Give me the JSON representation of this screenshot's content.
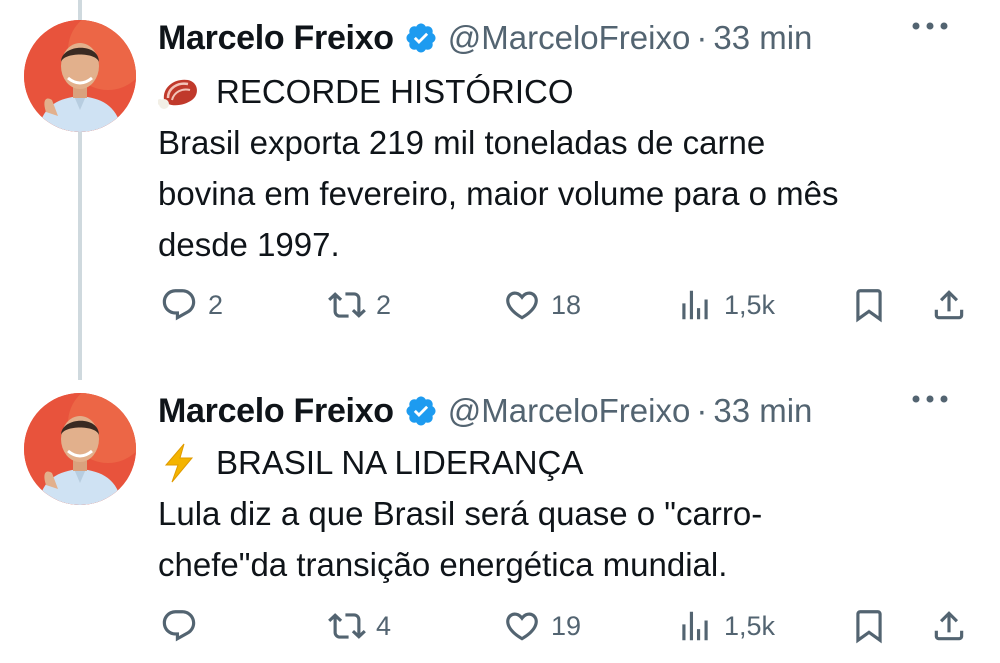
{
  "tweets": [
    {
      "name": "Marcelo Freixo",
      "handle": "@MarceloFreixo",
      "separator": "·",
      "time": "33 min",
      "title": "RECORDE HISTÓRICO",
      "title_emoji": "meat-on-bone-icon",
      "body": [
        "Brasil exporta 219 mil toneladas de carne",
        "bovina em fevereiro, maior volume para o mês",
        "desde 1997."
      ],
      "replies": "2",
      "retweets": "2",
      "likes": "18",
      "views": "1,5k"
    },
    {
      "name": "Marcelo Freixo",
      "handle": "@MarceloFreixo",
      "separator": "·",
      "time": "33 min",
      "title": "BRASIL NA LIDERANÇA",
      "title_emoji": "lightning-icon",
      "body": [
        "Lula diz a que Brasil será quase o \"carro-",
        "chefe\"da transição energética mundial."
      ],
      "replies": "",
      "retweets": "4",
      "likes": "19",
      "views": "1,5k"
    }
  ],
  "colors": {
    "verified_blue": "#1d9bf0",
    "muted_text": "#536471",
    "thread_line": "#cfd9de",
    "avatar_bg": "#e8533c"
  }
}
